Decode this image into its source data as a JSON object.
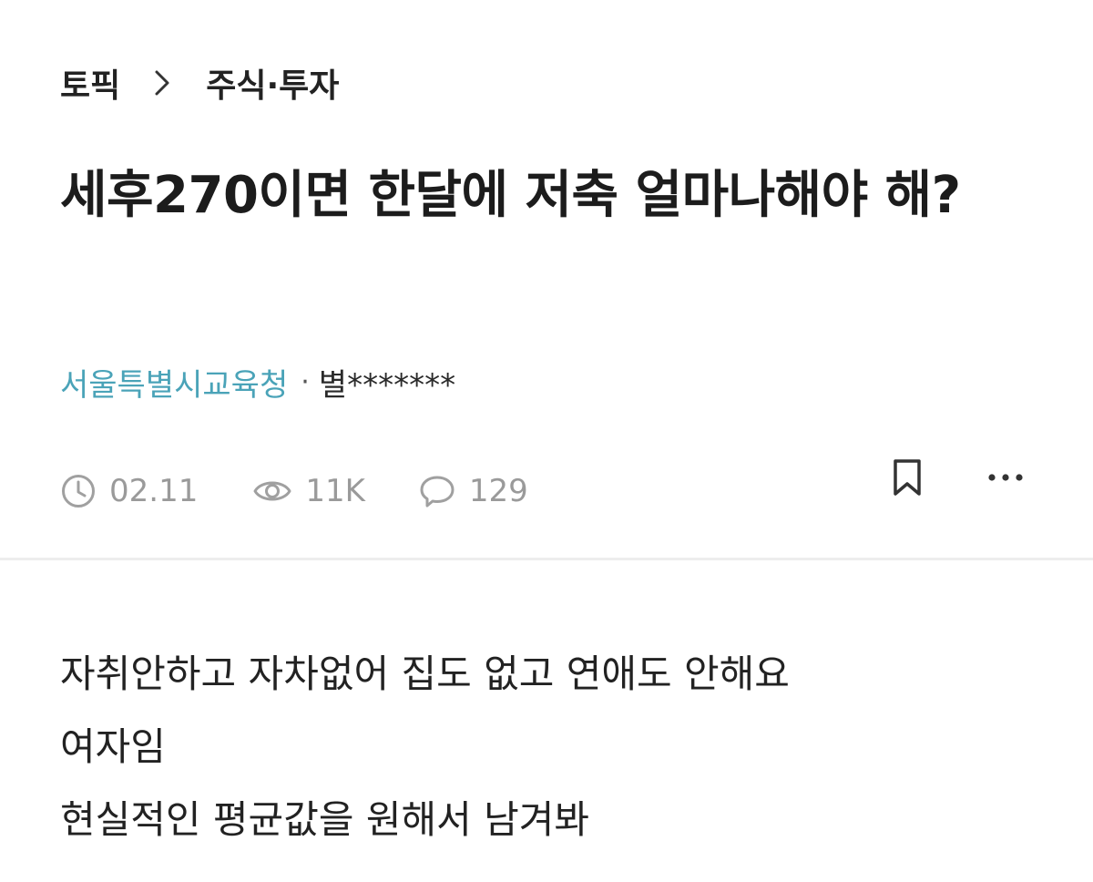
{
  "breadcrumb": {
    "root": "토픽",
    "separator_icon": "chevron-right-icon",
    "current": "주식·투자"
  },
  "post": {
    "title": "세후270이면 한달에 저축 얼마나해야 해?",
    "author_org": "서울특별시교육청",
    "author_separator": "·",
    "author_nick": "별*******",
    "date": "02.11",
    "views": "11K",
    "comments": "129",
    "body_lines": [
      "자취안하고 자차없어 집도 없고 연애도 안해요",
      "여자임",
      "현실적인 평균값을 원해서 남겨봐"
    ]
  },
  "icons": {
    "date": "clock-icon",
    "views": "eye-icon",
    "comments": "speech-bubble-icon",
    "bookmark": "bookmark-icon",
    "more": "more-dots-icon"
  },
  "colors": {
    "org_accent": "#4aa3b8",
    "meta_gray": "#9a9a9a",
    "text": "#1c1c1c",
    "divider": "#ededed"
  }
}
